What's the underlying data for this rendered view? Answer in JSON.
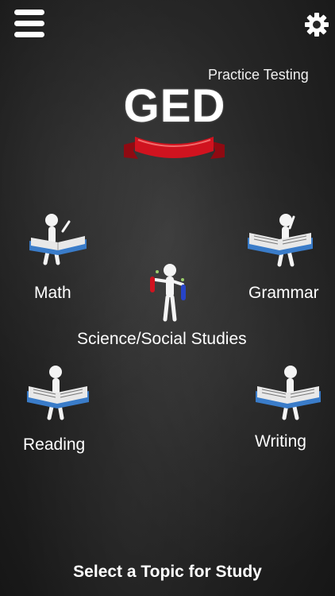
{
  "header": {
    "menu_icon": "hamburger-menu-icon",
    "settings_icon": "gear-icon",
    "subtitle": "Practice Testing",
    "logo_text": "GED"
  },
  "topics": {
    "math": {
      "label": "Math",
      "icon": "stick-figure-reading-book-icon"
    },
    "grammar": {
      "label": "Grammar",
      "icon": "stick-figure-reading-book-icon"
    },
    "science": {
      "label": "Science/Social Studies",
      "icon": "stick-figure-test-tubes-icon"
    },
    "reading": {
      "label": "Reading",
      "icon": "stick-figure-reading-book-icon"
    },
    "writing": {
      "label": "Writing",
      "icon": "stick-figure-reading-book-icon"
    }
  },
  "footer": {
    "prompt": "Select a Topic for Study"
  },
  "colors": {
    "background": "#262626",
    "text": "#ffffff",
    "ribbon": "#c8101c",
    "book_cover": "#3a7cc9"
  }
}
